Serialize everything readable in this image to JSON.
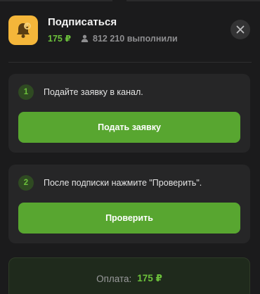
{
  "task": {
    "title": "Подписаться",
    "price": "175 ₽",
    "completed_count": "812 210 выполнили"
  },
  "steps": [
    {
      "number": "1",
      "text": "Подайте заявку в канал.",
      "button_label": "Подать заявку"
    },
    {
      "number": "2",
      "text": "После подписки нажмите \"Проверить\".",
      "button_label": "Проверить"
    }
  ],
  "payment": {
    "label": "Оплата:",
    "amount": "175 ₽"
  },
  "colors": {
    "accent_green": "#58a630",
    "price_green": "#6cc13b",
    "icon_yellow": "#f4b63a",
    "background": "#1b1b1c"
  },
  "icons": {
    "app": "bell-icon",
    "users": "user-icon",
    "close": "close-icon"
  }
}
